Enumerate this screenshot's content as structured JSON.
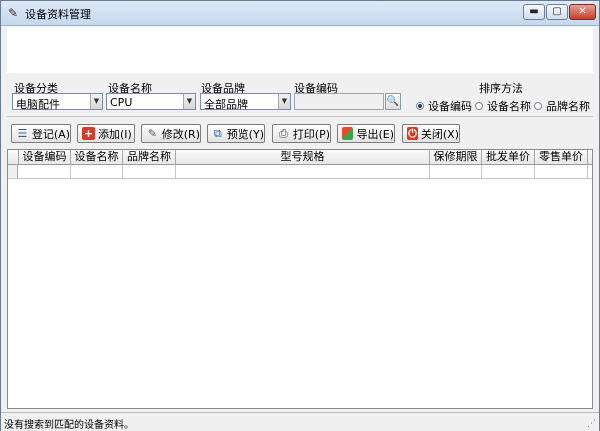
{
  "window": {
    "title": "设备资料管理",
    "controls": {
      "minimize": "▬",
      "maximize": "▢",
      "close": "✕"
    }
  },
  "filters": {
    "category_label": "设备分类",
    "category_value": "电脑配件",
    "name_label": "设备名称",
    "name_value": "CPU",
    "brand_label": "设备品牌",
    "brand_value": "全部品牌",
    "code_label": "设备编码",
    "code_value": ""
  },
  "sort": {
    "label": "排序方法",
    "options": [
      {
        "label": "设备编码",
        "selected": true
      },
      {
        "label": "设备名称",
        "selected": false
      },
      {
        "label": "品牌名称",
        "selected": false
      }
    ]
  },
  "toolbar": {
    "register": "登记(A)",
    "add": "添加(I)",
    "edit": "修改(R)",
    "preview": "预览(Y)",
    "print": "打印(P)",
    "export": "导出(E)",
    "close": "关闭(X)"
  },
  "table": {
    "columns": [
      "设备编码",
      "设备名称",
      "品牌名称",
      "型号规格",
      "保修期限",
      "批发单价",
      "零售单价"
    ],
    "rows": []
  },
  "status": {
    "message": "没有搜索到匹配的设备资料。"
  }
}
